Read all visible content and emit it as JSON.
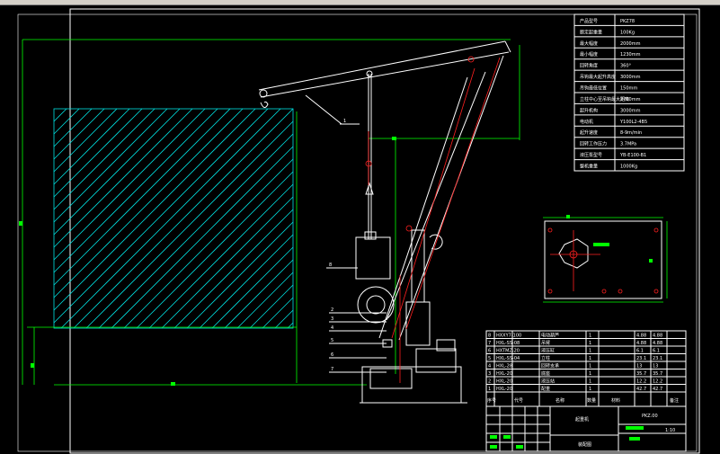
{
  "params_table": {
    "rows": [
      {
        "label": "产品型号",
        "value": "PKZ78"
      },
      {
        "label": "额定起重量",
        "value": "100Kg"
      },
      {
        "label": "最大幅度",
        "value": "2000mm"
      },
      {
        "label": "最小幅度",
        "value": "1230mm"
      },
      {
        "label": "回转角度",
        "value": "360°"
      },
      {
        "label": "吊钩最大起升高度",
        "value": "3000mm"
      },
      {
        "label": "吊钩最低位置",
        "value": "150mm"
      },
      {
        "label": "立柱中心至吊钩最大距离",
        "value": "2700mm"
      },
      {
        "label": "起升机构",
        "value": "3000mm"
      },
      {
        "label": "电动机",
        "value": "Y100L2-4B5"
      },
      {
        "label": "起升速度",
        "value": "8-9m/min"
      },
      {
        "label": "回转工作压力",
        "value": "3.7MPa"
      },
      {
        "label": "液压泵型号",
        "value": "YB-E100-B1"
      },
      {
        "label": "整机重量",
        "value": "1000Kg"
      }
    ]
  },
  "parts_list": {
    "rows": [
      {
        "no": "8",
        "code": "HXXY7-100",
        "name": "电动葫芦",
        "qty": "1",
        "weight": "4.88",
        "total": "4.88"
      },
      {
        "no": "7",
        "code": "HXL-SS-08",
        "name": "吊臂",
        "qty": "1",
        "weight": "4.88",
        "total": "4.88"
      },
      {
        "no": "6",
        "code": "HXTMZ-20",
        "name": "液压缸",
        "qty": "1",
        "weight": "6.1",
        "total": "6.1"
      },
      {
        "no": "5",
        "code": "HXL-SS-04",
        "name": "立柱",
        "qty": "1",
        "weight": "23.1",
        "total": "23.1"
      },
      {
        "no": "4",
        "code": "HXL-28",
        "name": "回转支承",
        "qty": "1",
        "weight": "13",
        "total": "13"
      },
      {
        "no": "3",
        "code": "HXL-20",
        "name": "底座",
        "qty": "1",
        "weight": "35.7",
        "total": "35.7"
      },
      {
        "no": "2",
        "code": "HXL-20",
        "name": "液压站",
        "qty": "1",
        "weight": "12.2",
        "total": "12.2"
      },
      {
        "no": "1",
        "code": "HXL-20",
        "name": "配重",
        "qty": "1",
        "weight": "42.7",
        "total": "42.7"
      }
    ],
    "header": {
      "no": "序号",
      "code": "代号",
      "name": "名称",
      "qty": "数量",
      "material": "材料",
      "note": "备注"
    }
  },
  "title_block": {
    "drawing_name": "装配图",
    "drawing_no": "PKZ.00",
    "scale": "1:10",
    "company": "起重机"
  },
  "callouts": [
    "1",
    "2",
    "3",
    "4",
    "5",
    "6",
    "7",
    "8"
  ],
  "colors": {
    "background": "#000000",
    "frame": "#ffffff",
    "dimension": "#00ff00",
    "centerline": "#ff2020",
    "hatch": "#00e0e0"
  }
}
